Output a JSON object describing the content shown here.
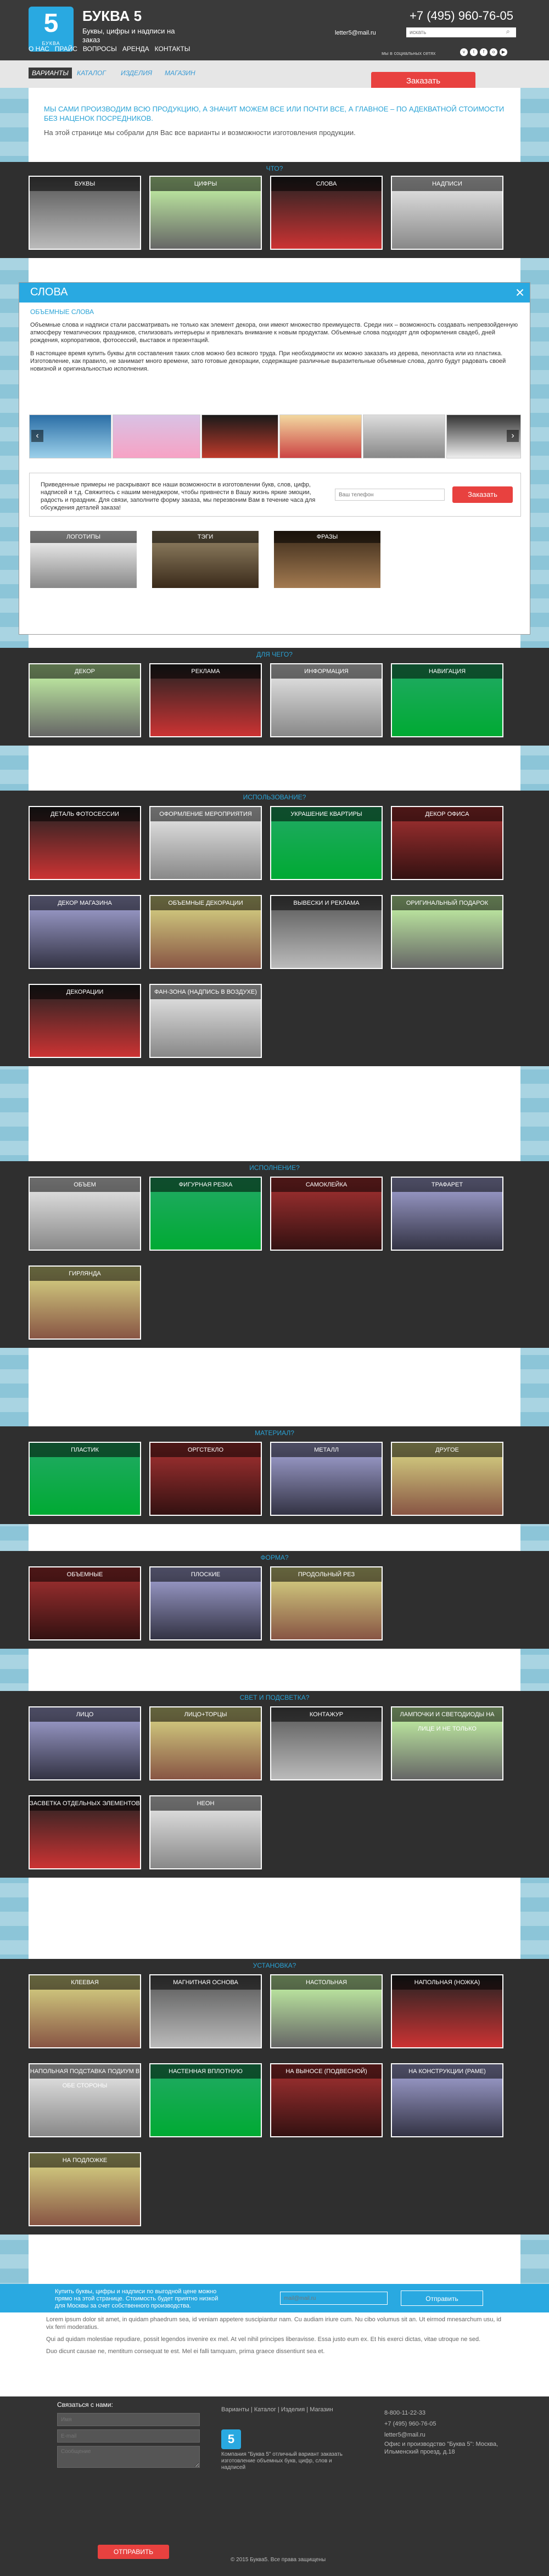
{
  "header": {
    "logo_letter": "5",
    "logo_small": "БУКВА",
    "brand_title": "БУКВА 5",
    "brand_subtitle": "Буквы, цифры и надписи на заказ",
    "nav": [
      "О НАС",
      "ПРАЙС",
      "ВОПРОСЫ",
      "АРЕНДА",
      "КОНТАКТЫ"
    ],
    "phone": "+7 (495) 960-76-05",
    "email": "letter5@mail.ru",
    "search_placeholder": "искать",
    "social_label": "мы в социальных сетях"
  },
  "menu": {
    "items": [
      "ВАРИАНТЫ",
      "КАТАЛОГ",
      "ИЗДЕЛИЯ",
      "МАГАЗИН"
    ],
    "order_button": "Заказать"
  },
  "intro": {
    "headline": "МЫ САМИ ПРОИЗВОДИМ ВСЮ ПРОДУКЦИЮ, А ЗНАЧИТ МОЖЕМ ВСЕ ИЛИ ПОЧТИ ВСЕ, А ГЛАВНОЕ – ПО АДЕКВАТНОЙ СТОИМОСТИ БЕЗ НАЦЕНОК ПОСРЕДНИКОВ.",
    "text": "На этой странице мы собрали для Вас все варианты и возможности изготовления продукции."
  },
  "sections": [
    {
      "title": "ЧТО?",
      "tiles": [
        "БУКВЫ",
        "ЦИФРЫ",
        "СЛОВА",
        "НАДПИСИ"
      ]
    },
    {
      "title": "ДЛЯ ЧЕГО?",
      "tiles": [
        "ДЕКОР",
        "РЕКЛАМА",
        "ИНФОРМАЦИЯ",
        "НАВИГАЦИЯ"
      ]
    },
    {
      "title": "ИСПОЛЬЗОВАНИЕ?",
      "tiles": [
        "ДЕТАЛЬ ФОТОСЕССИИ",
        "ОФОРМЛЕНИЕ МЕРОПРИЯТИЯ",
        "УКРАШЕНИЕ КВАРТИРЫ",
        "ДЕКОР ОФИСА",
        "ДЕКОР МАГАЗИНА",
        "ОБЪЕМНЫЕ ДЕКОРАЦИИ",
        "ВЫВЕСКИ И РЕКЛАМА",
        "ОРИГИНАЛЬНЫЙ ПОДАРОК",
        "ДЕКОРАЦИИ",
        "ФАН-ЗОНА (НАДПИСЬ В ВОЗДУХЕ)"
      ]
    },
    {
      "title": "ИСПОЛНЕНИЕ?",
      "tiles": [
        "ОБЪЕМ",
        "ФИГУРНАЯ РЕЗКА",
        "САМОКЛЕЙКА",
        "ТРАФАРЕТ",
        "ГИРЛЯНДА"
      ]
    },
    {
      "title": "МАТЕРИАЛ?",
      "tiles": [
        "ПЛАСТИК",
        "ОРГСТЕКЛО",
        "МЕТАЛЛ",
        "ДРУГОЕ"
      ]
    },
    {
      "title": "ФОРМА?",
      "tiles": [
        "ОБЪЕМНЫЕ",
        "ПЛОСКИЕ",
        "ПРОДОЛЬНЫЙ РЕЗ"
      ]
    },
    {
      "title": "СВЕТ И ПОДСВЕТКА?",
      "tiles": [
        "ЛИЦО",
        "ЛИЦО+ТОРЦЫ",
        "КОНТАЖУР",
        "ЛАМПОЧКИ И СВЕТОДИОДЫ НА ЛИЦЕ И НЕ ТОЛЬКО",
        "ЗАСВЕТКА ОТДЕЛЬНЫХ ЭЛЕМЕНТОВ",
        "НЕОН"
      ]
    },
    {
      "title": "УСТАНОВКА?",
      "tiles": [
        "КЛЕЕВАЯ",
        "МАГНИТНАЯ ОСНОВА",
        "НАСТОЛЬНАЯ",
        "НАПОЛЬНАЯ (НОЖКА)",
        "НАПОЛЬНАЯ ПОДСТАВКА ПОДИУМ В ОБЕ СТОРОНЫ",
        "НАСТЕННАЯ ВПЛОТНУЮ",
        "НА ВЫНОСЕ (ПОДВЕСНОЙ)",
        "НА КОНСТРУКЦИИ (РАМЕ)",
        "НА ПОДЛОЖКЕ"
      ]
    }
  ],
  "modal": {
    "title": "СЛОВА",
    "subtitle": "ОБЪЕМНЫЕ СЛОВА",
    "text1": "Объемные слова и надписи стали рассматривать не только как элемент декора, они имеют множество преимуществ. Среди них – возможность создавать непревзойденную атмосферу тематических праздников, стилизовать интерьеры и привлекать внимание к новым продуктам. Объемные слова подходят для оформления свадеб, дней рождения, корпоративов, фотосессий, выставок и презентаций.",
    "text2": "В настоящее время купить буквы для составления таких слов можно без всякого труда. При необходимости их можно заказать из дерева, пенопласта или из пластика. Изготовление, как правило, не занимает много времени, зато готовые декорации, содержащие различные выразительные объемные слова, долго будут радовать своей новизной и оригинальностью исполнения.",
    "cta_text": "Приведенные примеры не раскрывают все наши возможности в изготовлении букв, слов, цифр, надписей и т.д. Свяжитесь с нашим менеджером, чтобы привнести в Вашу жизнь яркие эмоции, радость и праздник. Для связи, заполните форму заказа, мы перезвоним Вам в течение часа для обсуждения деталей заказа!",
    "cta_placeholder": "Ваш телефон",
    "cta_button": "Заказать",
    "extra_tiles": [
      "ЛОГОТИПЫ",
      "ТЭГИ",
      "ФРАЗЫ"
    ]
  },
  "subscribe": {
    "text": "Купить буквы, цифры и надписи по выгодной цене можно прямо на этой странице. Стоимость будет приятно низкой для Москвы за счет собственного производства.",
    "placeholder": "mail@mail.ru",
    "button": "Отправить"
  },
  "lorem": [
    "Lorem ipsum dolor sit amet, in quidam phaedrum sea, id veniam appetere suscipiantur nam. Cu audiam iriure cum. Nu cibo volumus sit an. Ut eirmod mnesarchum usu, id vix ferri moderatius.",
    "Qui ad quidam molestiae repudiare, possit legendos invenire ex mel. At vel nihil principes liberavisse. Essa justo eum ex. Et his exerci dictas, vitae utroque ne sed.",
    "Duo dicunt causae ne, mentitum consequat te est. Mel ei falli tamquam, prima graece dissentiunt sea et."
  ],
  "footer": {
    "title": "Связаться с нами:",
    "name_placeholder": "Имя",
    "email_placeholder": "E-mail",
    "message_placeholder": "Сообщение",
    "send": "ОТПРАВИТЬ",
    "links": [
      "Варианты",
      "Каталог",
      "Изделия",
      "Магазин"
    ],
    "info": "Компания \"Буква 5\" отличный вариант заказать изготовление объемных букв, цифр, слов и надписей",
    "phone1": "8-800-11-22-33",
    "phone2": "+7 (495) 960-76-05",
    "email": "letter5@mail.ru",
    "address": "Офис и производство \"Буква 5\": Москва, Ильменский проезд, д.18",
    "copyright": "© 2015 Буква5. Все права защищены"
  },
  "icons": {
    "close": "close-icon",
    "arrow_left": "arrow-left-icon",
    "arrow_right": "arrow-right-icon",
    "search": "search-icon"
  },
  "colors": {
    "accent": "#29a9e1",
    "cta": "#e8413f",
    "dark": "#2f2f2f"
  }
}
